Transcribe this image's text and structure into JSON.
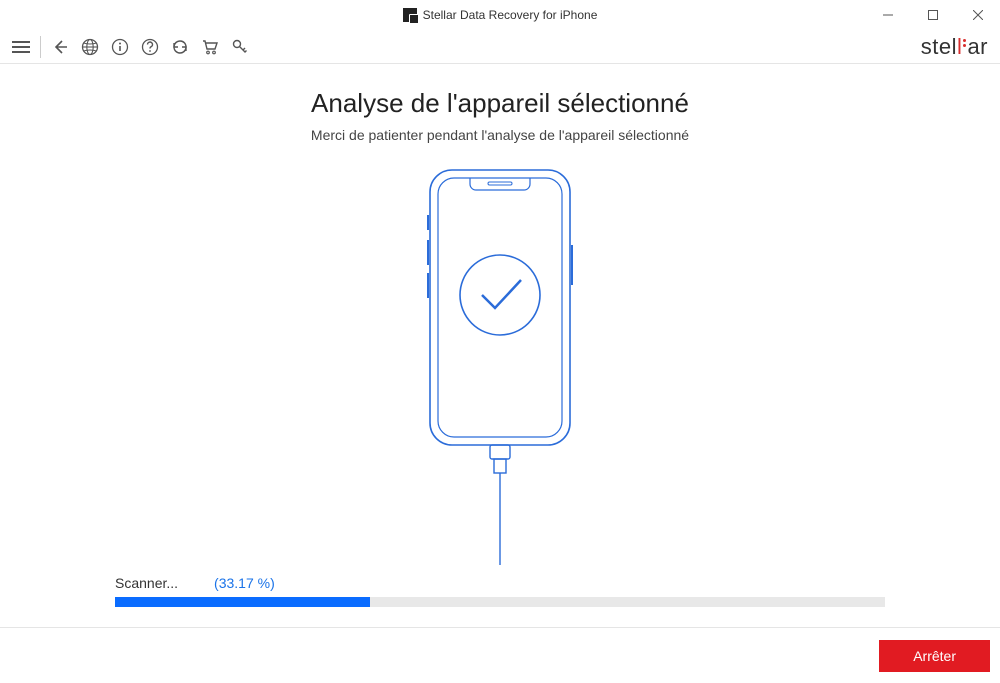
{
  "titlebar": {
    "app_title": "Stellar Data Recovery for iPhone"
  },
  "toolbar": {
    "brand_part1": "stel",
    "brand_part2_prefix": "l",
    "brand_part2_suffix": "ar"
  },
  "main": {
    "title": "Analyse de l'appareil sélectionné",
    "subtitle": "Merci de patienter pendant l'analyse de l'appareil sélectionné"
  },
  "progress": {
    "status_label": "Scanner...",
    "percent_label": "(33.17 %)",
    "percent_value": 33.17
  },
  "footer": {
    "stop_label": "Arrêter"
  }
}
